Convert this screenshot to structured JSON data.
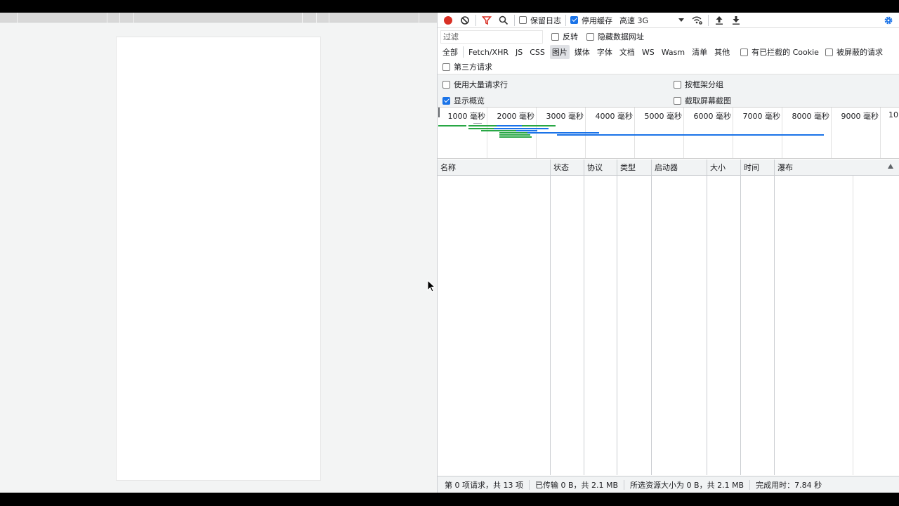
{
  "toolbar": {
    "preserve_log_label": "保留日志",
    "disable_cache_label": "停用缓存",
    "throttle_value": "高速 3G"
  },
  "filter": {
    "placeholder": "过滤",
    "invert_label": "反转",
    "hide_data_urls_label": "隐藏数据网址"
  },
  "types": [
    {
      "label": "全部",
      "active": false
    },
    {
      "label": "Fetch/XHR",
      "active": false
    },
    {
      "label": "JS",
      "active": false
    },
    {
      "label": "CSS",
      "active": false
    },
    {
      "label": "图片",
      "active": true
    },
    {
      "label": "媒体",
      "active": false
    },
    {
      "label": "字体",
      "active": false
    },
    {
      "label": "文档",
      "active": false
    },
    {
      "label": "WS",
      "active": false
    },
    {
      "label": "Wasm",
      "active": false
    },
    {
      "label": "清单",
      "active": false
    },
    {
      "label": "其他",
      "active": false
    }
  ],
  "blocked_cookies_label": "有已拦截的 Cookie",
  "blocked_requests_label": "被屏蔽的请求",
  "third_party_label": "第三方请求",
  "options": {
    "large_rows_label": "使用大量请求行",
    "group_by_frame_label": "按框架分组",
    "show_overview_label": "显示概览",
    "capture_screenshots_label": "截取屏幕截图"
  },
  "overview": {
    "ticks": [
      "1000 毫秒",
      "2000 毫秒",
      "3000 毫秒",
      "4000 毫秒",
      "5000 毫秒",
      "6000 毫秒",
      "7000 毫秒",
      "8000 毫秒",
      "9000 毫秒",
      "10"
    ]
  },
  "columns": [
    "名称",
    "状态",
    "协议",
    "类型",
    "启动器",
    "大小",
    "时间",
    "瀑布"
  ],
  "status": {
    "requests": "第 0 项请求，共 13 项",
    "transferred": "已传输 0 B，共 2.1 MB",
    "resources": "所选资源大小为 0 B，共 2.1 MB",
    "finish": "完成用时：7.84 秒"
  },
  "colors": {
    "record": "#d93025",
    "accent": "#1a73e8",
    "bar_green": "#28a745",
    "bar_blue": "#1a73e8"
  }
}
